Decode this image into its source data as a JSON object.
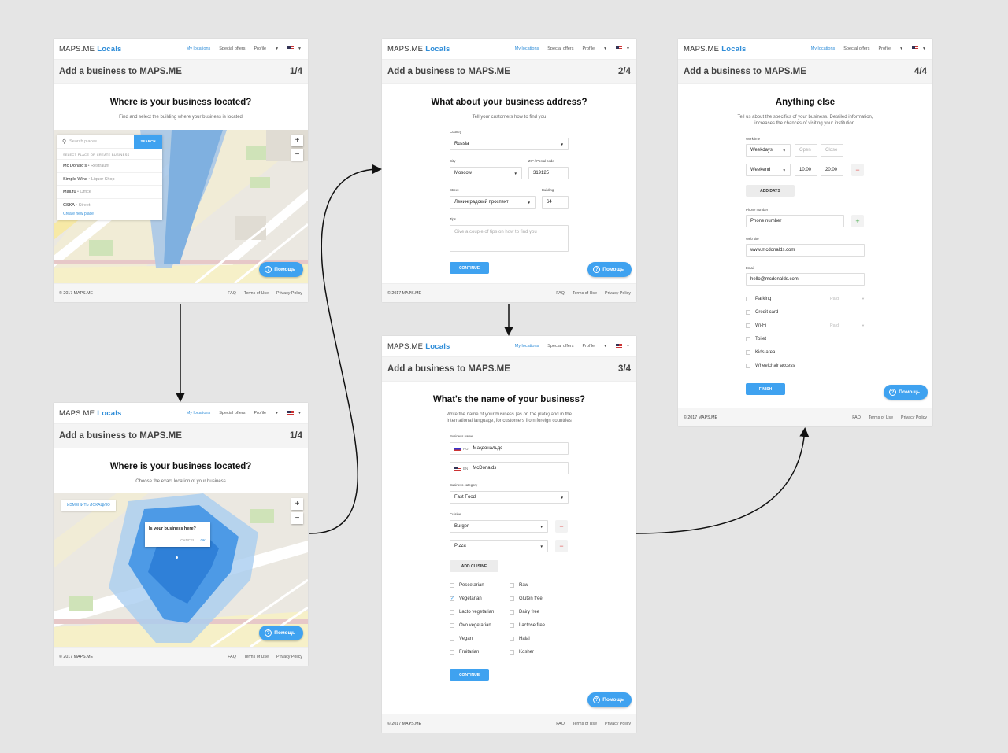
{
  "header": {
    "brand_main": "MAPS.ME",
    "brand_accent": "Locals",
    "nav_my_locations": "My locations",
    "nav_special_offers": "Special offers",
    "nav_profile": "Profile"
  },
  "page_title": "Add a business to MAPS.ME",
  "footer": {
    "copyright": "© 2017 MAPS.ME",
    "faq": "FAQ",
    "terms": "Terms of Use",
    "privacy": "Privacy Policy"
  },
  "help_label": "Помощь",
  "screen1": {
    "step": "1/4",
    "heading": "Where is your business located?",
    "subtitle": "Find and select the building where your business is located",
    "search_placeholder": "Search places",
    "search_button": "SEARCH",
    "list_header": "SELECT PLACE OR CREATE BUSINESS",
    "results": [
      {
        "name": "Mc Donald's",
        "type": "Restraunt"
      },
      {
        "name": "Simple Wine",
        "type": "Liquor Shop"
      },
      {
        "name": "Mail.ru",
        "type": "Office"
      },
      {
        "name": "CSKA",
        "type": "Street"
      }
    ],
    "create_link": "Create new place"
  },
  "screen1b": {
    "step": "1/4",
    "heading": "Where is your business located?",
    "subtitle": "Choose the exact location of your business",
    "change_location": "ИЗМЕНИТЬ ЛОКАЦИЮ",
    "popup_question": "Is your business here?",
    "popup_cancel": "CANCEL",
    "popup_ok": "OK"
  },
  "screen2": {
    "step": "2/4",
    "heading": "What about your business address?",
    "subtitle": "Tell your customers how to find you",
    "country_label": "Country",
    "country_value": "Russia",
    "city_label": "City",
    "city_value": "Moscow",
    "zip_label": "ZIP / Postal code",
    "zip_value": "319125",
    "street_label": "Street",
    "street_value": "Ленинградский проспект",
    "building_label": "Building",
    "building_value": "64",
    "tips_label": "Tips",
    "tips_placeholder": "Give a couple of tips on how to find you",
    "continue": "CONTINUE"
  },
  "screen3": {
    "step": "3/4",
    "heading": "What's the name of your business?",
    "subtitle_line1": "Write the name of your business (as on the plate) and in the",
    "subtitle_line2": "international language, for customers from foreign countries",
    "name_label": "Business name",
    "name_ru_lang": "RU",
    "name_ru_value": "Макдональдс",
    "name_en_lang": "EN",
    "name_en_value": "McDonalds",
    "category_label": "Business category",
    "category_value": "Fast Food",
    "cuisine_label": "Cuisine",
    "cuisine1": "Burger",
    "cuisine2": "Pizza",
    "add_cuisine": "ADD CUISINE",
    "diet_left": [
      "Pescetarian",
      "Vegetarian",
      "Lacto vegetarian",
      "Ovo vegetarian",
      "Vegan",
      "Fruitarian"
    ],
    "diet_right": [
      "Raw",
      "Gluten free",
      "Dairy free",
      "Lactose free",
      "Halal",
      "Kosher"
    ],
    "continue": "CONTINUE"
  },
  "screen4": {
    "step": "4/4",
    "heading": "Anything else",
    "subtitle_line1": "Tell us about the specifics of your business. Detailed information,",
    "subtitle_line2": "increases the chances of visiting your institution.",
    "worktime_label": "Worktime",
    "row1_days": "Weekdays",
    "row1_open": "Open",
    "row1_close": "Close",
    "row2_days": "Weekend",
    "row2_open": "10:00",
    "row2_close": "20:00",
    "add_days": "ADD DAYS",
    "phone_label": "Phone number",
    "phone_value": "Phone number",
    "web_label": "Web site",
    "web_value": "www.mcdonalds.com",
    "email_label": "Email",
    "email_value": "hello@mcdonalds.com",
    "amenities": [
      "Parking",
      "Credit card",
      "Wi-Fi",
      "Toilet",
      "Kids area",
      "Wheelchair access"
    ],
    "paid_label": "Paid",
    "finish": "FINISH"
  },
  "colors": {
    "accent": "#3fa2f0",
    "brand": "#2f8dd8",
    "danger": "#e25858",
    "success": "#4caf50"
  }
}
